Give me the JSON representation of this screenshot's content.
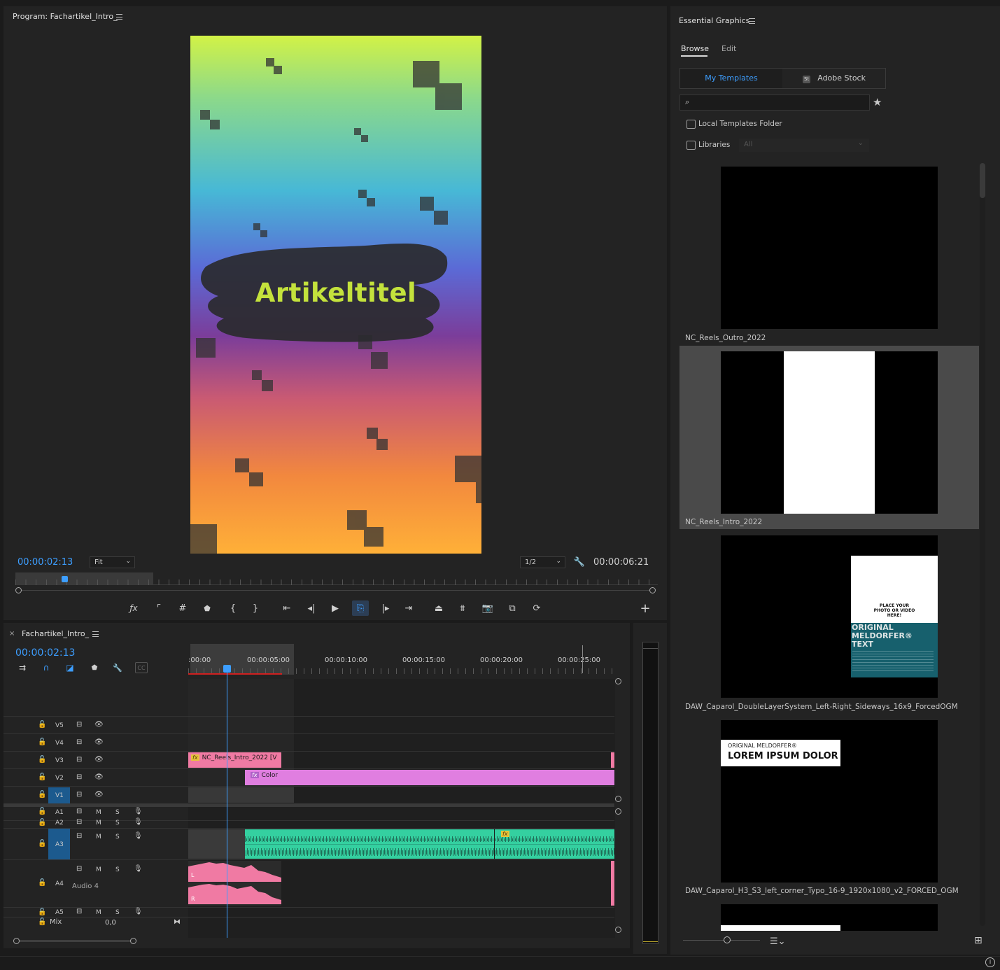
{
  "program_monitor": {
    "title": "Program: Fachartikel_Intro_",
    "video_title_text": "Artikeltitel",
    "current_timecode": "00:00:02:13",
    "zoom_value": "Fit",
    "resolution_value": "1/2",
    "duration_timecode": "00:00:06:21"
  },
  "timeline": {
    "title": "Fachartikel_Intro_",
    "current_timecode": "00:00:02:13",
    "ruler_labels": [
      ":00:00",
      "00:00:05:00",
      "00:00:10:00",
      "00:00:15:00",
      "00:00:20:00",
      "00:00:25:00"
    ],
    "tracks": {
      "v5": "V5",
      "v4": "V4",
      "v3": "V3",
      "v2": "V2",
      "v1": "V1",
      "a1": "A1",
      "a2": "A2",
      "a3": "A3",
      "a4": "A4",
      "a5": "A5",
      "mix": "Mix",
      "audio4_name": "Audio 4",
      "mix_value": "0,0"
    },
    "mute_label": "M",
    "solo_label": "S",
    "clips": {
      "v3_clip": "NC_Reels_Intro_2022 [V",
      "v2_clip": "Color",
      "fx_badge": "fx",
      "channel_l": "L",
      "channel_r": "R"
    }
  },
  "essential_graphics": {
    "title": "Essential Graphics",
    "tabs": [
      "Browse",
      "Edit"
    ],
    "source_tabs": [
      "My Templates",
      "Adobe Stock"
    ],
    "stock_badge": "St",
    "search_placeholder": "",
    "local_templates_label": "Local Templates Folder",
    "libraries_label": "Libraries",
    "libraries_value": "All",
    "templates": [
      {
        "name": "NC_Reels_Outro_2022"
      },
      {
        "name": "NC_Reels_Intro_2022"
      },
      {
        "name": "DAW_Caparol_DoubleLayerSystem_Left-Right_Sideways_16x9_ForcedOGM"
      },
      {
        "name": "DAW_Caparol_H3_S3_left_corner_Typo_16-9_1920x1080_v2_FORCED_OGM"
      }
    ],
    "thumb3": {
      "placeholder": "PLACE YOUR PHOTO OR VIDEO HERE!",
      "brand_line1": "ORIGINAL",
      "brand_line2": "MELDORFER®",
      "brand_line3": "TEXT"
    },
    "thumb4": {
      "brand_small": "ORIGINAL MELDORFER®",
      "headline": "LOREM IPSUM DOLOR"
    }
  },
  "colors": {
    "accent_blue": "#3d9eff",
    "clip_pink": "#f07aa3",
    "clip_violet": "#e07ee0",
    "clip_teal": "#34d0a0"
  }
}
